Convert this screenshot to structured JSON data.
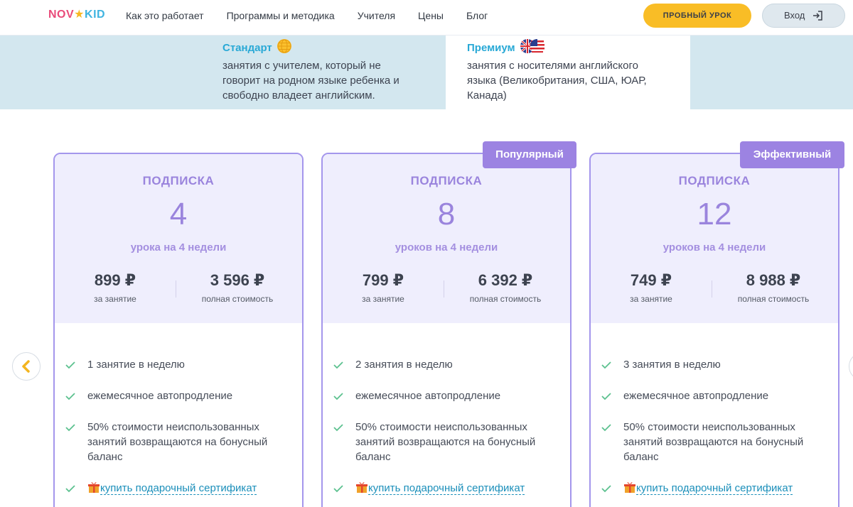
{
  "header": {
    "logo": [
      "NOV",
      "★",
      "KID"
    ],
    "nav": [
      "Как это работает",
      "Программы и методика",
      "Учителя",
      "Цены",
      "Блог"
    ],
    "trial_label": "ПРОБНЫЙ УРОК",
    "login_label": "Вход"
  },
  "teacher_types": {
    "standard": {
      "title": "Стандарт",
      "desc_lines": [
        "занятия с учителем, который не",
        "говорит на родном языке ребенка и",
        "свободно владеет английским."
      ]
    },
    "premium": {
      "title": "Премиум",
      "desc_lines": [
        "занятия с носителями английского",
        "языка (Великобритания, США, ЮАР,",
        "Канада)"
      ]
    }
  },
  "plans": [
    {
      "badge": "",
      "label": "ПОДПИСКА",
      "count": "4",
      "sub": "урока на 4 недели",
      "price_per": "899 ₽",
      "price_per_label": "за занятие",
      "price_total": "3 596 ₽",
      "price_total_label": "полная стоимость",
      "features": [
        "1 занятие в неделю",
        "ежемесячное автопродление",
        "50% стоимости неиспользованных занятий возвращаются на бонусный баланс"
      ],
      "gift": "купить подарочный сертификат"
    },
    {
      "badge": "Популярный",
      "label": "ПОДПИСКА",
      "count": "8",
      "sub": "уроков на 4 недели",
      "price_per": "799 ₽",
      "price_per_label": "за занятие",
      "price_total": "6 392 ₽",
      "price_total_label": "полная стоимость",
      "features": [
        "2 занятия в неделю",
        "ежемесячное автопродление",
        "50% стоимости неиспользованных занятий возвращаются на бонусный баланс"
      ],
      "gift": "купить подарочный сертификат"
    },
    {
      "badge": "Эффективный",
      "label": "ПОДПИСКА",
      "count": "12",
      "sub": "уроков на 4 недели",
      "price_per": "749 ₽",
      "price_per_label": "за занятие",
      "price_total": "8 988 ₽",
      "price_total_label": "полная стоимость",
      "features": [
        "3 занятия в неделю",
        "ежемесячное автопродление",
        "50% стоимости неиспользованных занятий возвращаются на бонусный баланс"
      ],
      "gift": "купить подарочный сертификат"
    }
  ],
  "carousel": {
    "prev_icon": "chevron-left-icon",
    "next_icon": "chevron-right-icon"
  },
  "colors": {
    "accent": "#9c83e2",
    "trial": "#f9bd26",
    "link": "#1b8fba",
    "band": "#d3e7ef"
  }
}
